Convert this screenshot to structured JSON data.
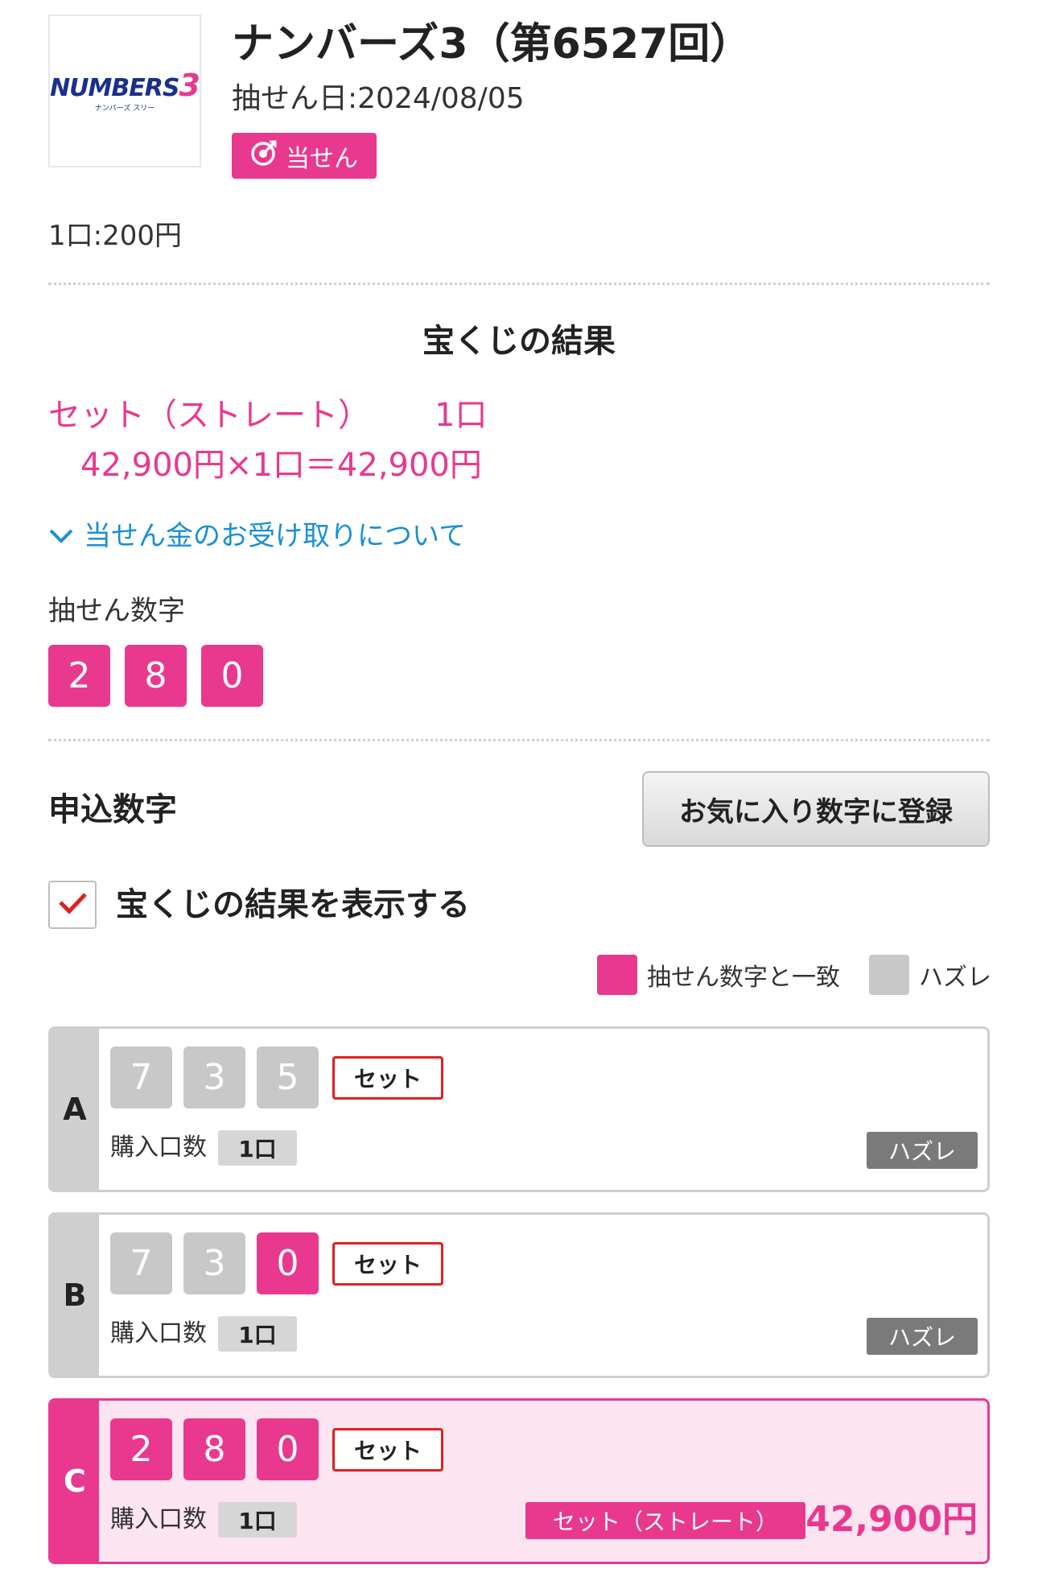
{
  "header": {
    "logo": {
      "brand": "NUMBERS",
      "digit": "3",
      "kana": "ナンバーズ スリー"
    },
    "title": "ナンバーズ3（第6527回）",
    "draw_date": "抽せん日:2024/08/05",
    "status_badge": "当せん",
    "price": "1口:200円"
  },
  "results": {
    "title": "宝くじの結果",
    "prize_type": "セット（ストレート）",
    "prize_count": "1口",
    "prize_calc": "42,900円×1口＝42,900円",
    "receive_link": "当せん金のお受け取りについて",
    "winning_label": "抽せん数字",
    "winning_numbers": [
      "2",
      "8",
      "0"
    ]
  },
  "entries_section": {
    "title": "申込数字",
    "favorite_button": "お気に入り数字に登録",
    "show_results_label": "宝くじの結果を表示する",
    "show_results_checked": true,
    "legend_match": "抽せん数字と一致",
    "legend_miss": "ハズレ",
    "qty_label": "購入口数"
  },
  "entries": [
    {
      "letter": "A",
      "digits": [
        "7",
        "3",
        "5"
      ],
      "hits": [
        false,
        false,
        false
      ],
      "type": "セット",
      "qty": "1口",
      "result": "ハズレ"
    },
    {
      "letter": "B",
      "digits": [
        "7",
        "3",
        "0"
      ],
      "hits": [
        false,
        false,
        true
      ],
      "type": "セット",
      "qty": "1口",
      "result": "ハズレ"
    },
    {
      "letter": "C",
      "digits": [
        "2",
        "8",
        "0"
      ],
      "hits": [
        true,
        true,
        true
      ],
      "type": "セット",
      "qty": "1口",
      "win_type": "セット（ストレート）",
      "win_amount": "42,900円"
    }
  ],
  "colors": {
    "accent": "#e8398f",
    "miss": "#c8c8c8",
    "link": "#1a8fd6",
    "check": "#e02020"
  }
}
